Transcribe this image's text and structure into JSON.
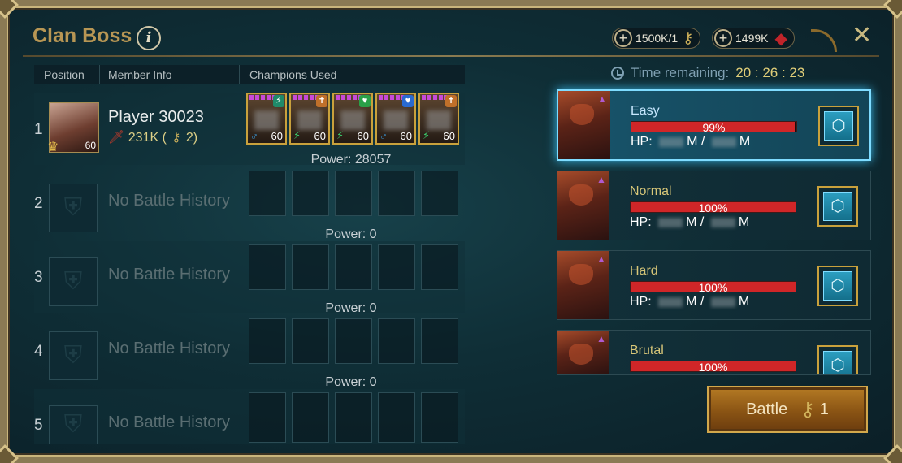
{
  "header": {
    "title": "Clan Boss",
    "info_icon": "i",
    "resources": [
      {
        "value": "1500K/1",
        "icon": "key-icon"
      },
      {
        "value": "1499K",
        "icon": "gem-icon"
      }
    ],
    "close": "✕"
  },
  "table": {
    "columns": [
      "Position",
      "Member Info",
      "Champions Used"
    ],
    "rows": [
      {
        "position": "1",
        "name": "Player 30023",
        "damage": "231K",
        "keys_open": "(",
        "keys": "2)",
        "avatar_level": "60",
        "champions": [
          {
            "level": "60",
            "affinity": "♂",
            "badge": "⚡"
          },
          {
            "level": "60",
            "affinity": "⚡",
            "badge": "✝"
          },
          {
            "level": "60",
            "affinity": "⚡",
            "badge": "♥"
          },
          {
            "level": "60",
            "affinity": "♂",
            "badge": "♥"
          },
          {
            "level": "60",
            "affinity": "⚡",
            "badge": "✝"
          }
        ],
        "power": "Power: 28057"
      },
      {
        "position": "2",
        "name": "No Battle History",
        "power": "Power: 0"
      },
      {
        "position": "3",
        "name": "No Battle History",
        "power": "Power: 0"
      },
      {
        "position": "4",
        "name": "No Battle History",
        "power": "Power: 0"
      },
      {
        "position": "5",
        "name": "No Battle History"
      }
    ]
  },
  "time": {
    "label": "Time remaining:",
    "value": "20 : 26 : 23"
  },
  "bosses": [
    {
      "difficulty": "Easy",
      "hp_percent": "99%",
      "hp_fraction": 0.99,
      "hp_label": "HP:",
      "hp_unit": "M",
      "hp_sep": "/",
      "selected": true
    },
    {
      "difficulty": "Normal",
      "hp_percent": "100%",
      "hp_fraction": 1.0,
      "hp_label": "HP:",
      "hp_unit": "M",
      "hp_sep": "/"
    },
    {
      "difficulty": "Hard",
      "hp_percent": "100%",
      "hp_fraction": 1.0,
      "hp_label": "HP:",
      "hp_unit": "M",
      "hp_sep": "/"
    },
    {
      "difficulty": "Brutal",
      "hp_percent": "100%",
      "hp_fraction": 1.0
    }
  ],
  "battle": {
    "label": "Battle",
    "keys": "1"
  },
  "colors": {
    "gold": "#c9a13c",
    "accent": "#7fdcff",
    "hp_red": "#d02628",
    "title": "#b79654"
  }
}
